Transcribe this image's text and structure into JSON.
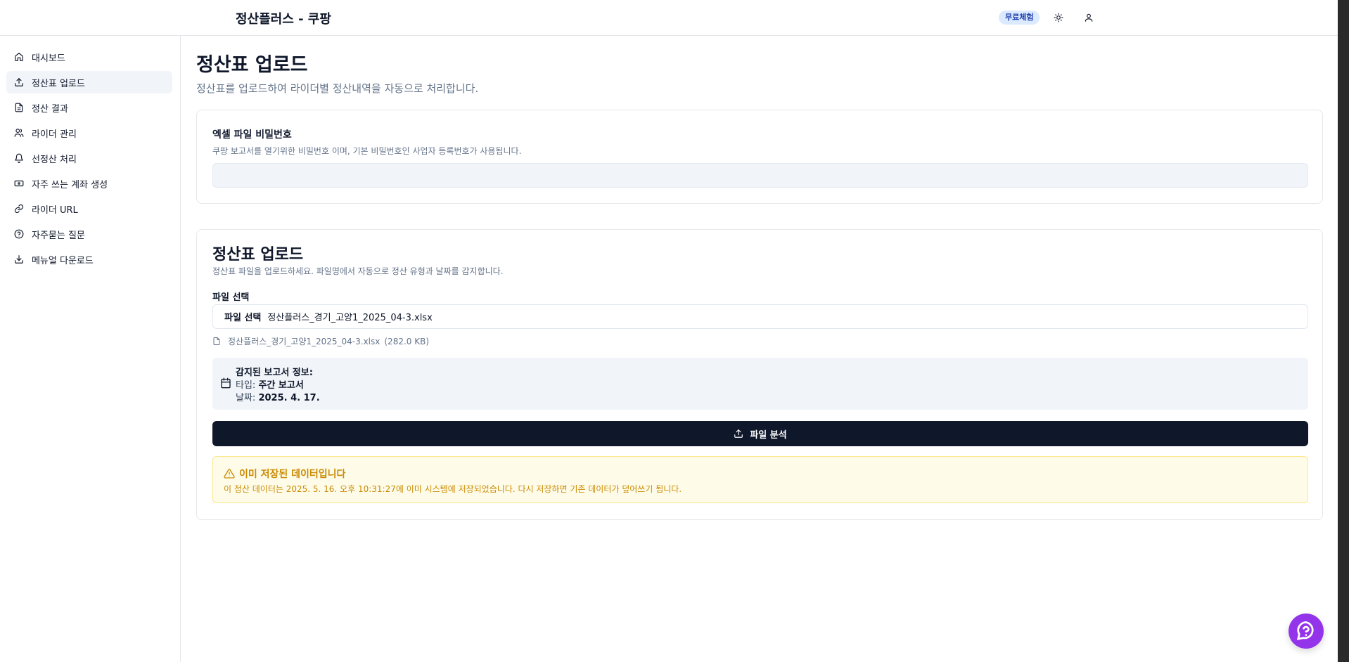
{
  "header": {
    "title": "정산플러스 - 쿠팡",
    "badge": "무료체험",
    "theme_icon": "sun-icon",
    "user_icon": "user-icon"
  },
  "sidebar": {
    "items": [
      {
        "label": "대시보드",
        "icon": "home-icon",
        "active": false
      },
      {
        "label": "정산표 업로드",
        "icon": "upload-icon",
        "active": true
      },
      {
        "label": "정산 결과",
        "icon": "file-text-icon",
        "active": false
      },
      {
        "label": "라이더 관리",
        "icon": "users-icon",
        "active": false
      },
      {
        "label": "선정산 처리",
        "icon": "bell-icon",
        "active": false
      },
      {
        "label": "자주 쓰는 계좌 생성",
        "icon": "banknote-icon",
        "active": false
      },
      {
        "label": "라이더 URL",
        "icon": "link-icon",
        "active": false
      },
      {
        "label": "자주묻는 질문",
        "icon": "help-circle-icon",
        "active": false
      },
      {
        "label": "메뉴얼 다운로드",
        "icon": "download-icon",
        "active": false
      }
    ]
  },
  "main": {
    "title": "정산표 업로드",
    "description": "정산표를 업로드하여 라이더별 정산내역을 자동으로 처리합니다.",
    "password_card": {
      "title": "엑셀 파일 비밀번호",
      "description": "쿠팡 보고서를 열기위한 비밀번호 이며, 기본 비밀번호인 사업자 등록번호가 사용됩니다.",
      "value": ""
    },
    "upload_card": {
      "title": "정산표 업로드",
      "description": "정산표 파일을 업로드하세요. 파일명에서 자동으로 정산 유형과 날짜를 감지합니다.",
      "field_label": "파일 선택",
      "file_button": "파일 선택",
      "file_name": "정산플러스_경기_고양1_2025_04-3.xlsx",
      "file_info_name": "정산플러스_경기_고양1_2025_04-3.xlsx",
      "file_info_size": "(282.0 KB)",
      "detected": {
        "title": "감지된 보고서 정보:",
        "type_label": "타입:",
        "type_value": "주간 보고서",
        "date_label": "날짜:",
        "date_value": "2025. 4. 17."
      },
      "analyze_button": "파일 분석",
      "warning": {
        "title": "이미 저장된 데이터입니다",
        "text": "이 정산 데이터는 2025. 5. 16. 오후 10:31:27에 이미 시스템에 저장되었습니다. 다시 저장하면 기존 데이터가 덮어쓰기 됩니다."
      }
    }
  },
  "colors": {
    "primary": "#0f172a",
    "badge_bg": "#dbeafe",
    "warning": "#ca8a04",
    "fab": "#9333ea"
  }
}
